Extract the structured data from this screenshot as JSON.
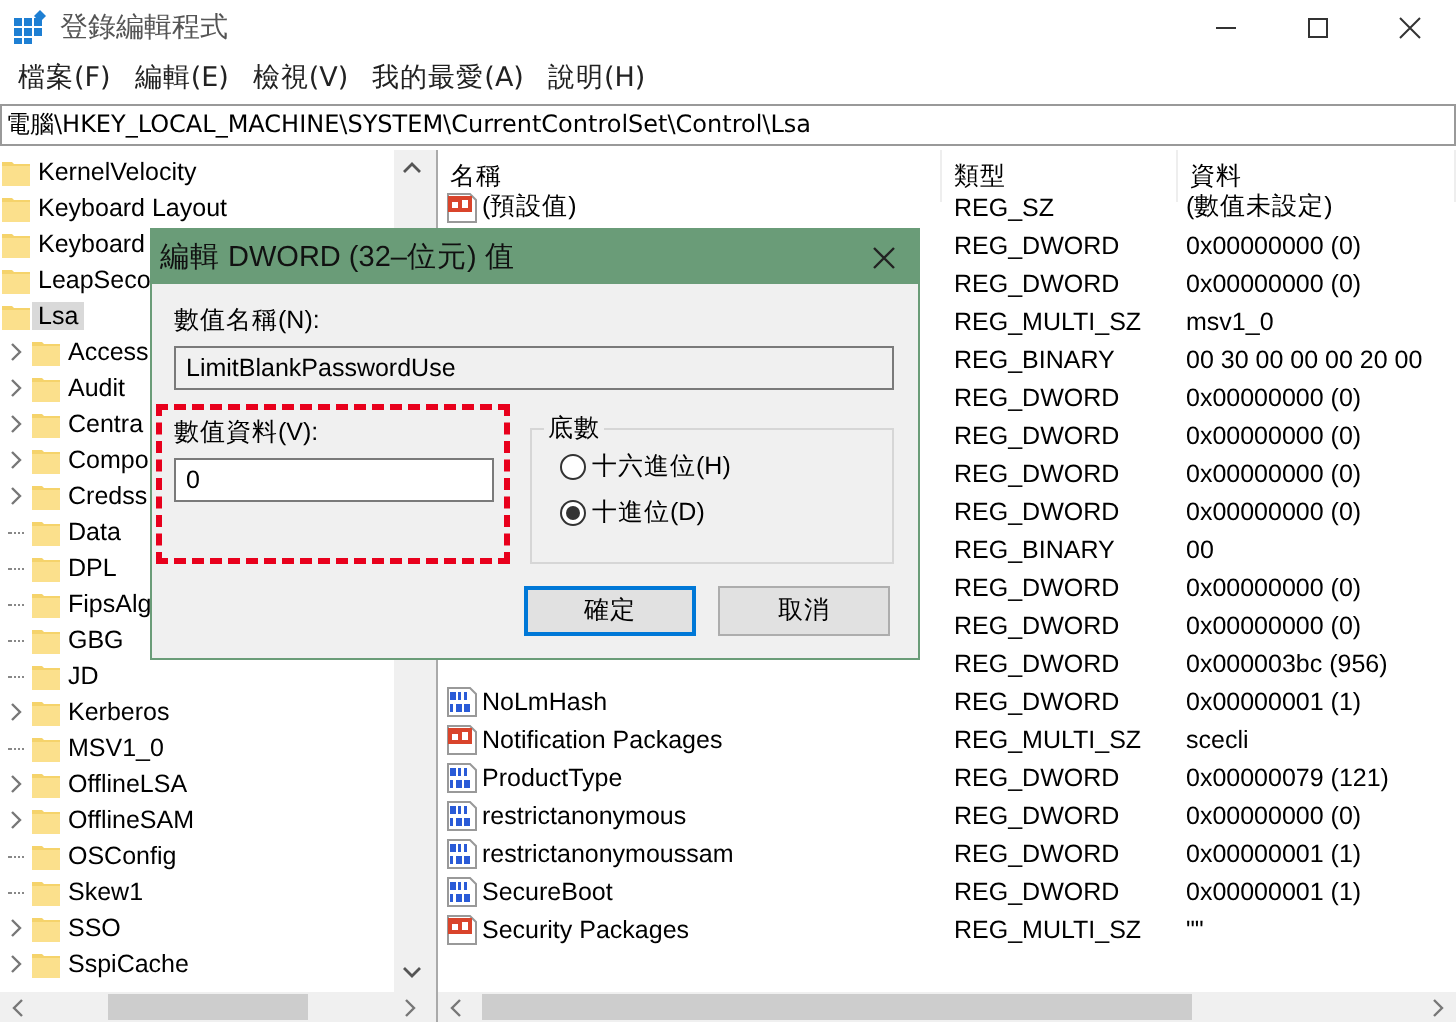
{
  "window": {
    "title": "登錄編輯程式"
  },
  "menu": [
    {
      "label": "檔案(F)"
    },
    {
      "label": "編輯(E)"
    },
    {
      "label": "檢視(V)"
    },
    {
      "label": "我的最愛(A)"
    },
    {
      "label": "說明(H)"
    }
  ],
  "address": "電腦\\HKEY_LOCAL_MACHINE\\SYSTEM\\CurrentControlSet\\Control\\Lsa",
  "tree": {
    "items": [
      {
        "label": "KernelVelocity",
        "selected": false
      },
      {
        "label": "Keyboard Layout",
        "selected": false
      },
      {
        "label": "Keyboard",
        "selected": false
      },
      {
        "label": "LeapSeco",
        "selected": false
      },
      {
        "label": "Lsa",
        "selected": true,
        "children": [
          {
            "label": "Access",
            "selected": false,
            "has_children": true
          },
          {
            "label": "Audit",
            "selected": false,
            "has_children": true
          },
          {
            "label": "Centra",
            "selected": false,
            "has_children": true
          },
          {
            "label": "Compo",
            "selected": false,
            "has_children": true
          },
          {
            "label": "Credss",
            "selected": false,
            "has_children": true
          },
          {
            "label": "Data",
            "selected": false,
            "has_children": false
          },
          {
            "label": "DPL",
            "selected": false,
            "has_children": false
          },
          {
            "label": "FipsAlg",
            "selected": false,
            "has_children": false
          },
          {
            "label": "GBG",
            "selected": false,
            "has_children": false
          },
          {
            "label": "JD",
            "selected": false,
            "has_children": false
          },
          {
            "label": "Kerberos",
            "selected": false,
            "has_children": true
          },
          {
            "label": "MSV1_0",
            "selected": false,
            "has_children": false
          },
          {
            "label": "OfflineLSA",
            "selected": false,
            "has_children": true
          },
          {
            "label": "OfflineSAM",
            "selected": false,
            "has_children": true
          },
          {
            "label": "OSConfig",
            "selected": false,
            "has_children": false
          },
          {
            "label": "Skew1",
            "selected": false,
            "has_children": false
          },
          {
            "label": "SSO",
            "selected": false,
            "has_children": true
          },
          {
            "label": "SspiCache",
            "selected": false,
            "has_children": true
          }
        ]
      }
    ]
  },
  "values": {
    "columns": [
      "名稱",
      "類型",
      "資料"
    ],
    "rows": [
      {
        "kind": "string",
        "name": "(預設值)",
        "type": "REG_SZ",
        "data": "(數值未設定)"
      },
      {
        "type": "REG_DWORD",
        "data": "0x00000000 (0)"
      },
      {
        "type": "REG_DWORD",
        "data": "0x00000000 (0)"
      },
      {
        "type": "REG_MULTI_SZ",
        "data": "msv1_0"
      },
      {
        "type": "REG_BINARY",
        "data": "00 30 00 00 00 20 00"
      },
      {
        "type": "REG_DWORD",
        "data": "0x00000000 (0)"
      },
      {
        "type": "REG_DWORD",
        "data": "0x00000000 (0)"
      },
      {
        "type": "REG_DWORD",
        "data": "0x00000000 (0)"
      },
      {
        "type": "REG_DWORD",
        "data": "0x00000000 (0)"
      },
      {
        "type": "REG_BINARY",
        "data": "00"
      },
      {
        "type": "REG_DWORD",
        "data": "0x00000000 (0)"
      },
      {
        "type": "REG_DWORD",
        "data": "0x00000000 (0)"
      },
      {
        "type": "REG_DWORD",
        "data": "0x000003bc (956)"
      },
      {
        "kind": "binary",
        "name": "NoLmHash",
        "type": "REG_DWORD",
        "data": "0x00000001 (1)"
      },
      {
        "kind": "string",
        "name": "Notification Packages",
        "type": "REG_MULTI_SZ",
        "data": "scecli"
      },
      {
        "kind": "binary",
        "name": "ProductType",
        "type": "REG_DWORD",
        "data": "0x00000079 (121)"
      },
      {
        "kind": "binary",
        "name": "restrictanonymous",
        "type": "REG_DWORD",
        "data": "0x00000000 (0)"
      },
      {
        "kind": "binary",
        "name": "restrictanonymoussam",
        "type": "REG_DWORD",
        "data": "0x00000001 (1)"
      },
      {
        "kind": "binary",
        "name": "SecureBoot",
        "type": "REG_DWORD",
        "data": "0x00000001 (1)"
      },
      {
        "kind": "string",
        "name": "Security Packages",
        "type": "REG_MULTI_SZ",
        "data": "\"\""
      }
    ]
  },
  "dialog": {
    "title": "編輯 DWORD (32–位元) 值",
    "name_label": "數值名稱(N):",
    "name_value": "LimitBlankPasswordUse",
    "data_label": "數值資料(V):",
    "data_value": "0",
    "base_label": "底數",
    "radios": [
      {
        "label": "十六進位(H)",
        "selected": false
      },
      {
        "label": "十進位(D)",
        "selected": true
      }
    ],
    "buttons": [
      {
        "label": "確定",
        "default": true
      },
      {
        "label": "取消",
        "default": false
      }
    ]
  }
}
